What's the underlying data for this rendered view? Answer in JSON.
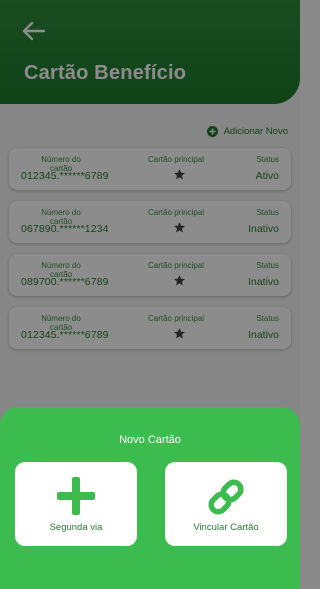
{
  "header": {
    "title": "Cartão Benefício"
  },
  "add_new_label": "Adicionar Novo",
  "cards": [
    {
      "number_label": "Número do cartão",
      "number": "012345.******6789",
      "main_label": "Cartão principal",
      "status_label": "Status",
      "status": "Ativo"
    },
    {
      "number_label": "Número do cartão",
      "number": "067890.******1234",
      "main_label": "Cartão principal",
      "status_label": "Status",
      "status": "Inativo"
    },
    {
      "number_label": "Número do cartão",
      "number": "089700.******6789",
      "main_label": "Cartão principal",
      "status_label": "Status",
      "status": "Inativo"
    },
    {
      "number_label": "Número do cartão",
      "number": "012345.******6789",
      "main_label": "Cartão principal",
      "status_label": "Status",
      "status": "Inativo"
    }
  ],
  "sheet": {
    "title": "Novo Cartão",
    "options": [
      {
        "label": "Segunda via",
        "icon": "plus-icon"
      },
      {
        "label": "Vincular Cartão",
        "icon": "link-icon"
      }
    ]
  },
  "colors": {
    "primary_green": "#1f7a2d",
    "sheet_green": "#3cbc4f",
    "text_green": "#2a7a35"
  }
}
